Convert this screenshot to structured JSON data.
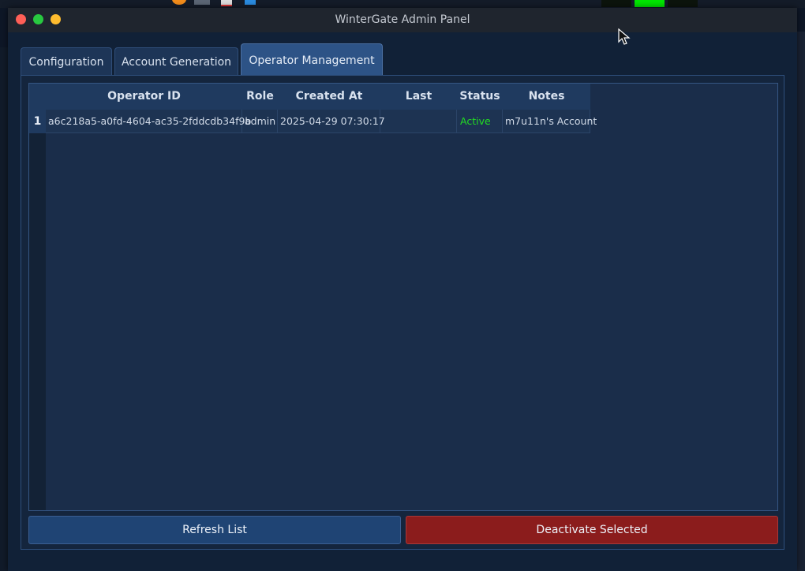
{
  "window": {
    "title": "WinterGate Admin Panel"
  },
  "tabs": [
    {
      "label": "Configuration",
      "active": false
    },
    {
      "label": "Account Generation",
      "active": false
    },
    {
      "label": "Operator Management",
      "active": true
    }
  ],
  "table": {
    "columns": [
      "Operator ID",
      "Role",
      "Created At",
      "Last Activity",
      "Status",
      "Notes"
    ],
    "rows": [
      {
        "index": "1",
        "operator_id": "a6c218a5-a0fd-4604-ac35-2fddcdb34f9b",
        "role": "admin",
        "created_at": "2025-04-29 07:30:17",
        "last_activity": "",
        "status": "Active",
        "notes": "m7u11n's Account"
      }
    ]
  },
  "buttons": {
    "refresh": "Refresh List",
    "deactivate": "Deactivate Selected"
  },
  "colors": {
    "status_active": "#22dd22",
    "danger": "#8b1c1c",
    "accent": "#2d5386"
  }
}
